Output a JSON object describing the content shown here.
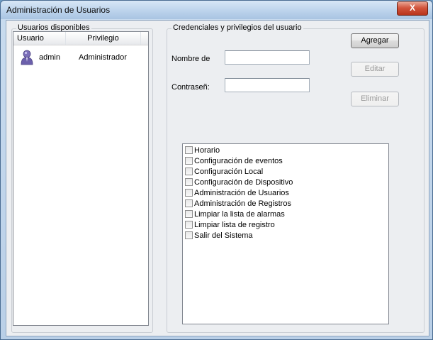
{
  "window": {
    "title": "Administración de Usuarios",
    "close_label": "X"
  },
  "users_group": {
    "legend": "Usuarios disponibles",
    "columns": [
      "Usuario",
      "Privilegio"
    ],
    "rows": [
      {
        "user": "admin",
        "privilege": "Administrador",
        "icon": "user-icon"
      }
    ]
  },
  "credentials_group": {
    "legend": "Credenciales y privilegios del usuario",
    "name_label": "Nombre de",
    "password_label": "Contraseñ:",
    "name_value": "",
    "password_value": ""
  },
  "buttons": {
    "add": "Agregar",
    "edit": "Editar",
    "delete": "Eliminar"
  },
  "permissions": [
    {
      "label": "Horario",
      "checked": false
    },
    {
      "label": "Configuración de eventos",
      "checked": false
    },
    {
      "label": "Configuración Local",
      "checked": false
    },
    {
      "label": "Configuración de Dispositivo",
      "checked": false
    },
    {
      "label": "Administración de Usuarios",
      "checked": false
    },
    {
      "label": "Administración de Registros",
      "checked": false
    },
    {
      "label": "Limpiar la lista de alarmas",
      "checked": false
    },
    {
      "label": "Limpiar lista de registro",
      "checked": false
    },
    {
      "label": "Salir del Sistema",
      "checked": false
    }
  ]
}
